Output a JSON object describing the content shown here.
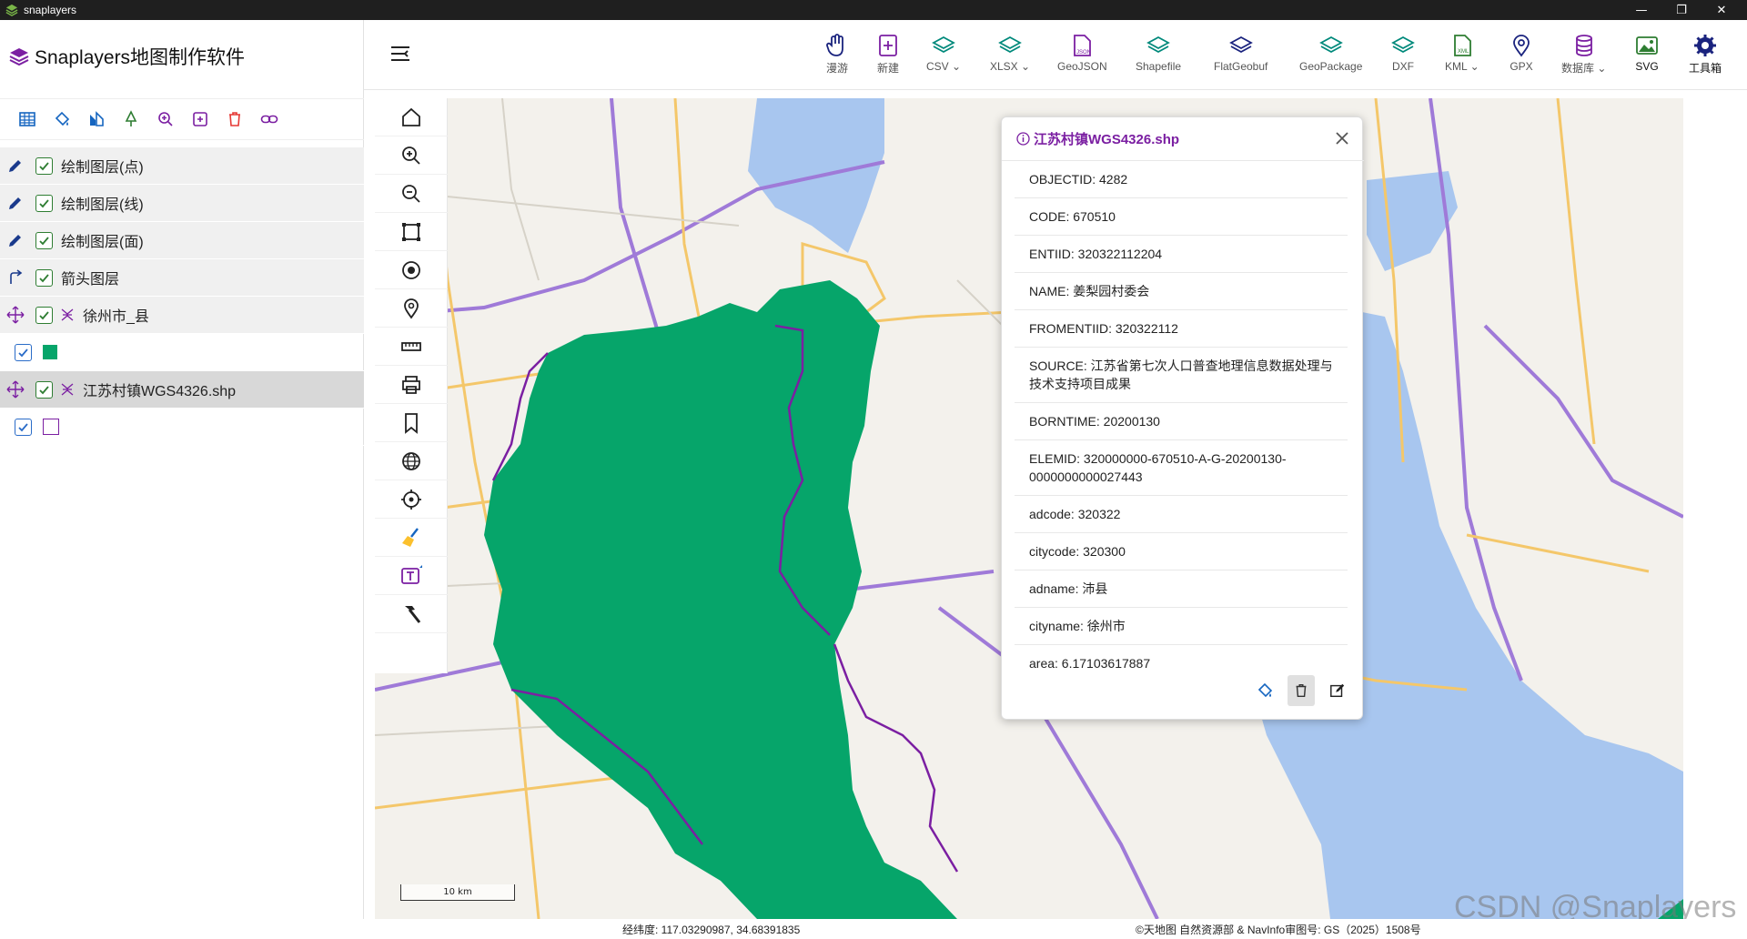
{
  "window": {
    "title": "snaplayers"
  },
  "app": {
    "title": "Snaplayers地图制作软件"
  },
  "layers": [
    {
      "label": "绘制图层(点)",
      "lead": "pencil-icon"
    },
    {
      "label": "绘制图层(线)",
      "lead": "pencil-icon"
    },
    {
      "label": "绘制图层(面)",
      "lead": "pencil-icon"
    },
    {
      "label": "箭头图层",
      "lead": "arrow-icon"
    },
    {
      "label": "徐州市_县",
      "lead": "move-icon"
    },
    {
      "label": "江苏村镇WGS4326.shp",
      "lead": "move-icon"
    }
  ],
  "toolbar": {
    "pan": "漫游",
    "new": "新建",
    "csv": "CSV",
    "xlsx": "XLSX",
    "geojson": "GeoJSON",
    "shapefile": "Shapefile",
    "flatgeobuf": "FlatGeobuf",
    "geopackage": "GeoPackage",
    "dxf": "DXF",
    "kml": "KML",
    "gpx": "GPX",
    "database": "数据库",
    "svg": "SVG",
    "toolbox": "工具箱"
  },
  "popup": {
    "title": "江苏村镇WGS4326.shp",
    "rows": [
      "OBJECTID:  4282",
      "CODE:  670510",
      "ENTIID:  320322112204",
      "NAME:  姜梨园村委会",
      "FROMENTIID:  320322112",
      "SOURCE:  江苏省第七次人口普查地理信息数据处理与技术支持项目成果",
      "BORNTIME:  20200130",
      "ELEMID:  320000000-670510-A-G-20200130-0000000000027443",
      "adcode:  320322",
      "citycode:  320300",
      "adname:  沛县",
      "cityname:  徐州市",
      "area:  6.17103617887"
    ]
  },
  "status": {
    "coord": "经纬度:  117.03290987, 34.68391835",
    "attribution": "©天地图 自然资源部 & NavInfo审图号: GS（2025）1508号",
    "scale": "10 km"
  },
  "watermark": "CSDN @Snaplayers",
  "colors": {
    "accent": "#7b1fa2",
    "polygon": "#06a56a",
    "water": "#a8c6ef",
    "road": "#f4c76a",
    "highway": "#9f7ad8"
  }
}
